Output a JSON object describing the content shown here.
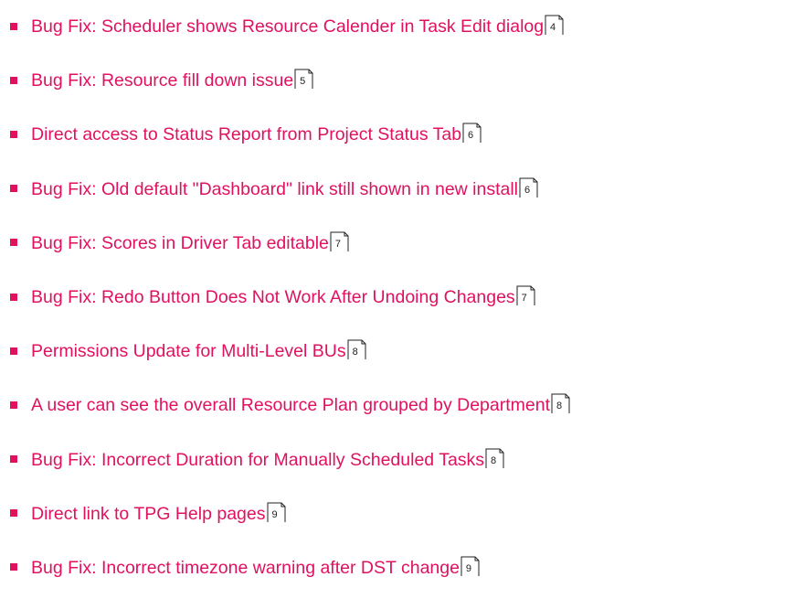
{
  "colors": {
    "link": "#e0115f",
    "bullet": "#e0115f",
    "page_ref": "#222222"
  },
  "icons": {
    "bullet": "square-bullet-icon",
    "page_ref": "folded-page-icon"
  },
  "toc": {
    "items": [
      {
        "label": "Bug Fix: Scheduler shows Resource Calender in Task Edit dialog",
        "page": "4"
      },
      {
        "label": "Bug Fix: Resource fill down issue",
        "page": "5"
      },
      {
        "label": "Direct access to Status Report from Project Status Tab",
        "page": "6"
      },
      {
        "label": "Bug Fix: Old default \"Dashboard\" link still shown in new install",
        "page": "6"
      },
      {
        "label": "Bug Fix: Scores in Driver Tab editable",
        "page": "7"
      },
      {
        "label": "Bug Fix: Redo Button Does Not Work After Undoing Changes",
        "page": "7"
      },
      {
        "label": "Permissions Update for Multi-Level BUs",
        "page": "8"
      },
      {
        "label": "A user can see the overall Resource Plan grouped by Department",
        "page": "8"
      },
      {
        "label": "Bug Fix: Incorrect Duration for Manually Scheduled Tasks",
        "page": "8"
      },
      {
        "label": "Direct link to TPG Help pages",
        "page": "9"
      },
      {
        "label": "Bug Fix: Incorrect timezone warning after DST change",
        "page": "9"
      }
    ]
  }
}
